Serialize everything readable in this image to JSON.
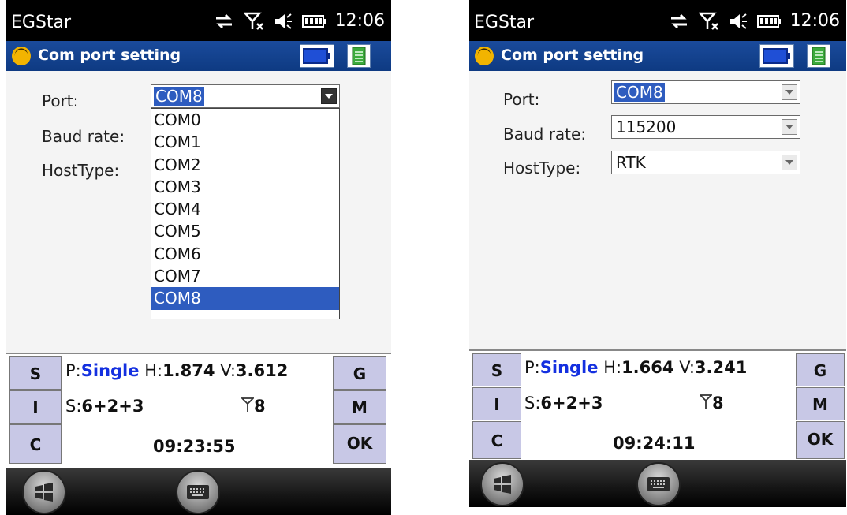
{
  "screens": [
    {
      "status_bar": {
        "carrier": "EGStar",
        "time": "12:06"
      },
      "title_bar": {
        "title": "Com port setting"
      },
      "form": {
        "port_label": "Port:",
        "port_value": "COM8",
        "baud_label": "Baud rate:",
        "hosttype_label": "HostType:",
        "dropdown_open": true,
        "port_options": [
          "COM0",
          "COM1",
          "COM2",
          "COM3",
          "COM4",
          "COM5",
          "COM6",
          "COM7",
          "COM8"
        ],
        "selected_option": "COM8"
      },
      "gps_panel": {
        "btn_s": "S",
        "btn_i": "I",
        "btn_c": "C",
        "btn_g": "G",
        "btn_m": "M",
        "btn_ok": "OK",
        "p_label": "P:",
        "p_value": "Single",
        "h_label": "H:",
        "h_value": "1.874",
        "v_label": "V:",
        "v_value": "3.612",
        "s_label": "S:",
        "s_value": "6+2+3",
        "antenna_count": "8",
        "clock": "09:23:55"
      }
    },
    {
      "status_bar": {
        "carrier": "EGStar",
        "time": "12:06"
      },
      "title_bar": {
        "title": "Com port setting"
      },
      "form": {
        "port_label": "Port:",
        "port_value": "COM8",
        "baud_label": "Baud rate:",
        "baud_value": "115200",
        "hosttype_label": "HostType:",
        "hosttype_value": "RTK",
        "dropdown_open": false
      },
      "gps_panel": {
        "btn_s": "S",
        "btn_i": "I",
        "btn_c": "C",
        "btn_g": "G",
        "btn_m": "M",
        "btn_ok": "OK",
        "p_label": "P:",
        "p_value": "Single",
        "h_label": "H:",
        "h_value": "1.664",
        "v_label": "V:",
        "v_value": "3.241",
        "s_label": "S:",
        "s_value": "6+2+3",
        "antenna_count": "8",
        "clock": "09:24:11"
      }
    }
  ],
  "colors": {
    "title_bar": "#0e3a82",
    "highlight": "#2e5cbf",
    "side_button": "#c8c8e6",
    "status_value": "#1430e0"
  }
}
